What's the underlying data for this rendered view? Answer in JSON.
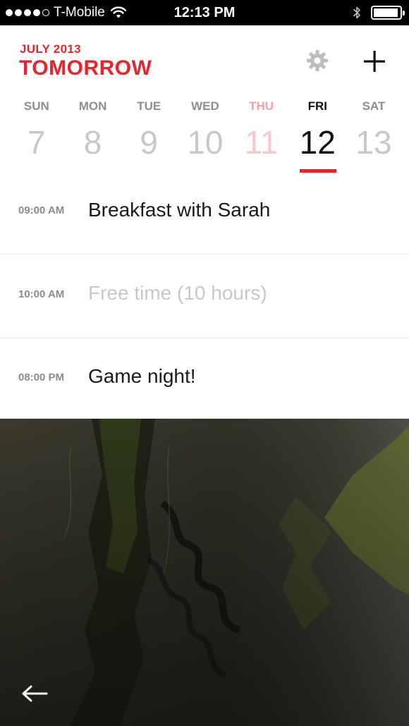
{
  "status_bar": {
    "carrier": "T-Mobile",
    "time": "12:13 PM",
    "signal_bars_filled": 4,
    "signal_bars_total": 5,
    "battery_level": 0.95
  },
  "header": {
    "month": "JULY 2013",
    "title": "TOMORROW",
    "icons": [
      "gear-icon",
      "plus-icon"
    ]
  },
  "week": {
    "days": [
      {
        "dow": "SUN",
        "num": "7",
        "state": "normal"
      },
      {
        "dow": "MON",
        "num": "8",
        "state": "normal"
      },
      {
        "dow": "TUE",
        "num": "9",
        "state": "normal"
      },
      {
        "dow": "WED",
        "num": "10",
        "state": "normal"
      },
      {
        "dow": "THU",
        "num": "11",
        "state": "today"
      },
      {
        "dow": "FRI",
        "num": "12",
        "state": "selected"
      },
      {
        "dow": "SAT",
        "num": "13",
        "state": "normal"
      }
    ]
  },
  "events": [
    {
      "time": "09:00 AM",
      "title": "Breakfast with Sarah",
      "kind": "event"
    },
    {
      "time": "10:00 AM",
      "title": "Free time (10 hours)",
      "kind": "free"
    },
    {
      "time": "08:00 PM",
      "title": "Game night!",
      "kind": "event"
    }
  ],
  "footer": {
    "back_icon": "arrow-left-icon"
  },
  "colors": {
    "accent": "#e3262b",
    "today_light": "#f1a1a3",
    "muted": "#c8c8c8"
  }
}
